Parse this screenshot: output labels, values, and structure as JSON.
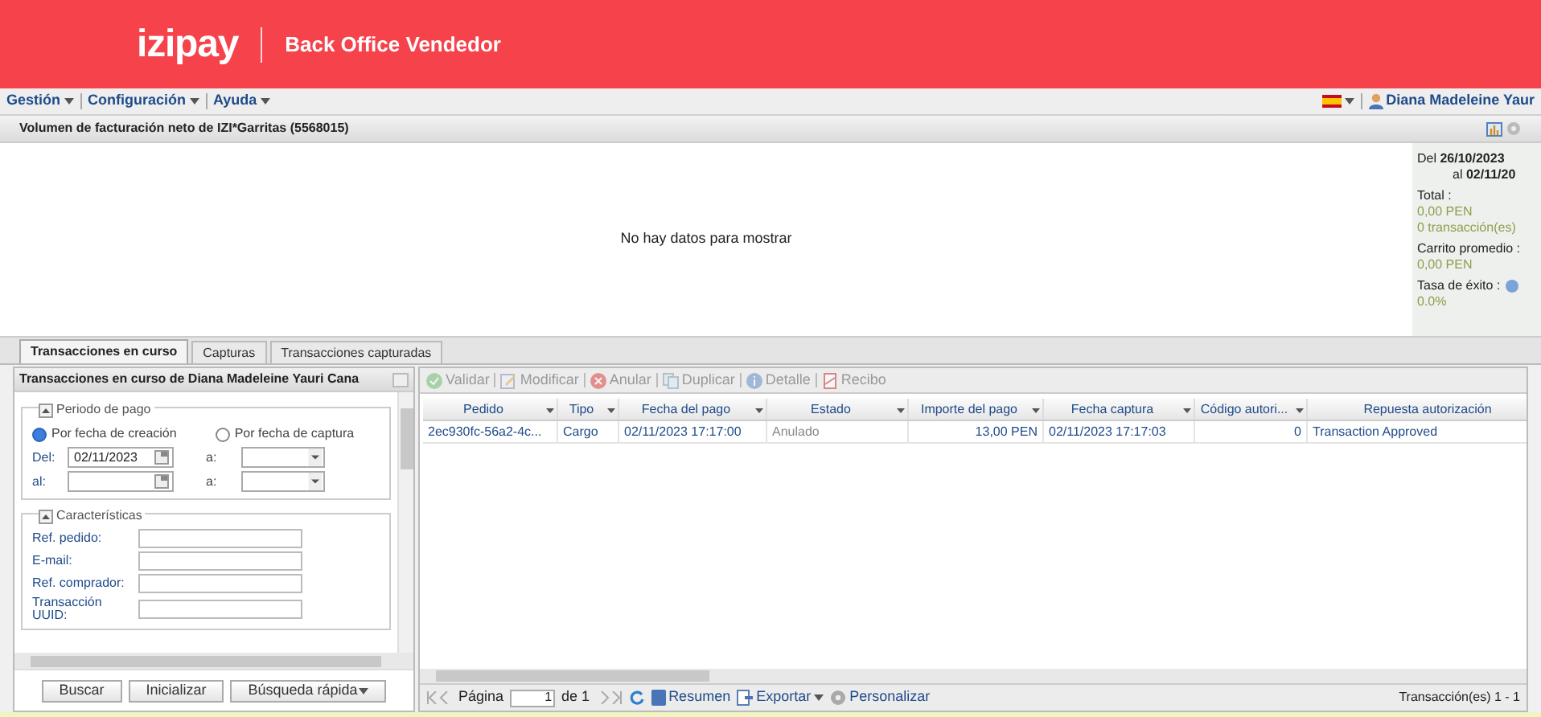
{
  "header": {
    "logo": "izipay",
    "title": "Back Office Vendedor"
  },
  "menu": [
    {
      "label": "Gestión"
    },
    {
      "label": "Configuración"
    },
    {
      "label": "Ayuda"
    }
  ],
  "user": {
    "name": "Diana Madeleine Yaur"
  },
  "volume_panel": {
    "title": "Volumen de facturación neto de IZI*Garritas (5568015)",
    "empty_message": "No hay datos para mostrar",
    "summary": {
      "from_label": "Del",
      "from": "26/10/2023",
      "to_label": "al",
      "to": "02/11/20",
      "stats": [
        {
          "label": "Total :",
          "values": [
            "0,00 PEN",
            "0 transacción(es)"
          ]
        },
        {
          "label": "Carrito promedio :",
          "values": [
            "0,00 PEN"
          ]
        },
        {
          "label": "Tasa de éxito :",
          "values": [
            "0.0%"
          ],
          "help": true
        }
      ]
    }
  },
  "tabs": [
    {
      "label": "Transacciones en curso",
      "selected": true
    },
    {
      "label": "Capturas",
      "selected": false
    },
    {
      "label": "Transacciones capturadas",
      "selected": false
    }
  ],
  "search_panel": {
    "title": "Transacciones en curso de Diana Madeleine Yauri Cana",
    "period": {
      "legend": "Periodo de pago",
      "radios": [
        {
          "label": "Por fecha de creación",
          "selected": true
        },
        {
          "label": "Por fecha de captura",
          "selected": false
        }
      ],
      "rows": [
        {
          "label": "Del:",
          "date": "02/11/2023",
          "time_label": "a:"
        },
        {
          "label": "al:",
          "date": "",
          "time_label": "a:"
        }
      ]
    },
    "features": {
      "legend": "Características",
      "fields": [
        {
          "label": "Ref. pedido:"
        },
        {
          "label": "E-mail:"
        },
        {
          "label": "Ref. comprador:"
        },
        {
          "label": "Transacción UUID:"
        }
      ]
    },
    "buttons": [
      {
        "label": "Buscar"
      },
      {
        "label": "Inicializar"
      },
      {
        "label": "Búsqueda rápida",
        "dropdown": true
      }
    ]
  },
  "toolbar": [
    {
      "label": "Validar",
      "kind": "check",
      "disabled": true
    },
    {
      "label": "Modificar",
      "kind": "edit",
      "disabled": true
    },
    {
      "label": "Anular",
      "kind": "cancel",
      "disabled": true
    },
    {
      "label": "Duplicar",
      "kind": "copy",
      "disabled": true
    },
    {
      "label": "Detalle",
      "kind": "info",
      "disabled": true
    },
    {
      "label": "Recibo",
      "kind": "pdf",
      "disabled": true
    }
  ],
  "table": {
    "columns": [
      "Pedido",
      "Tipo",
      "Fecha del pago",
      "Estado",
      "Importe del pago",
      "Fecha captura",
      "Código autori...",
      "Repuesta autorización"
    ],
    "rows": [
      {
        "cells": [
          "2ec930fc-56a2-4c...",
          "Cargo",
          "02/11/2023 17:17:00",
          "Anulado",
          "13,00 PEN",
          "02/11/2023 17:17:03",
          "0",
          "Transaction Approved"
        ]
      }
    ]
  },
  "paging": {
    "page_label": "Página",
    "page": "1",
    "of": "de 1",
    "actions": [
      {
        "label": "Resumen",
        "kind": "summary"
      },
      {
        "label": "Exportar",
        "kind": "export"
      },
      {
        "label": "Personalizar",
        "kind": "settings"
      }
    ],
    "status": "Transacción(es) 1 - 1"
  }
}
